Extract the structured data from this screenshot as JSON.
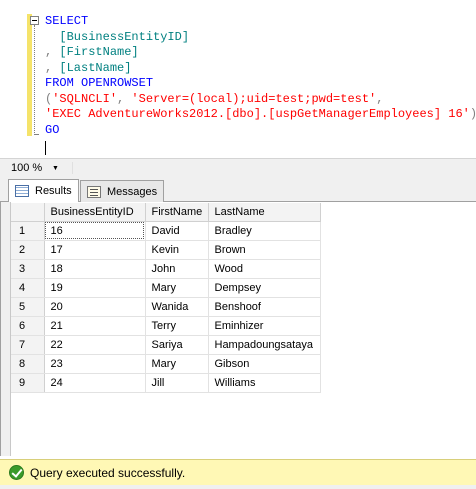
{
  "editor": {
    "lines": [
      [
        {
          "t": "SELECT",
          "c": "kw"
        }
      ],
      [
        {
          "t": "  [BusinessEntityID]",
          "c": "ident"
        }
      ],
      [
        {
          "t": ", ",
          "c": "gray"
        },
        {
          "t": "[FirstName]",
          "c": "ident"
        }
      ],
      [
        {
          "t": ", ",
          "c": "gray"
        },
        {
          "t": "[LastName]",
          "c": "ident"
        }
      ],
      [
        {
          "t": "FROM OPENROWSET",
          "c": "kw"
        }
      ],
      [
        {
          "t": "(",
          "c": "gray"
        },
        {
          "t": "'SQLNCLI'",
          "c": "str"
        },
        {
          "t": ", ",
          "c": "gray"
        },
        {
          "t": "'Server=(local);uid=test;pwd=test'",
          "c": "str"
        },
        {
          "t": ",",
          "c": "gray"
        }
      ],
      [
        {
          "t": "'EXEC AdventureWorks2012.[dbo].[uspGetManagerEmployees] 16'",
          "c": "str"
        },
        {
          "t": ");",
          "c": "gray"
        }
      ],
      [
        {
          "t": "GO",
          "c": "kw"
        }
      ]
    ]
  },
  "zoom": {
    "value": "100 %"
  },
  "tabs": {
    "results": "Results",
    "messages": "Messages"
  },
  "grid": {
    "columns": [
      "",
      "BusinessEntityID",
      "FirstName",
      "LastName"
    ],
    "rows": [
      [
        "1",
        "16",
        "David",
        "Bradley"
      ],
      [
        "2",
        "17",
        "Kevin",
        "Brown"
      ],
      [
        "3",
        "18",
        "John",
        "Wood"
      ],
      [
        "4",
        "19",
        "Mary",
        "Dempsey"
      ],
      [
        "5",
        "20",
        "Wanida",
        "Benshoof"
      ],
      [
        "6",
        "21",
        "Terry",
        "Eminhizer"
      ],
      [
        "7",
        "22",
        "Sariya",
        "Hampadoungsataya"
      ],
      [
        "8",
        "23",
        "Mary",
        "Gibson"
      ],
      [
        "9",
        "24",
        "Jill",
        "Williams"
      ]
    ]
  },
  "status": {
    "message": "Query executed successfully.",
    "icon": "check-circle-icon"
  },
  "colors": {
    "keyword": "#0000ff",
    "identifier": "#008080",
    "string": "#ff0000",
    "status_bg": "#fff8b5"
  }
}
